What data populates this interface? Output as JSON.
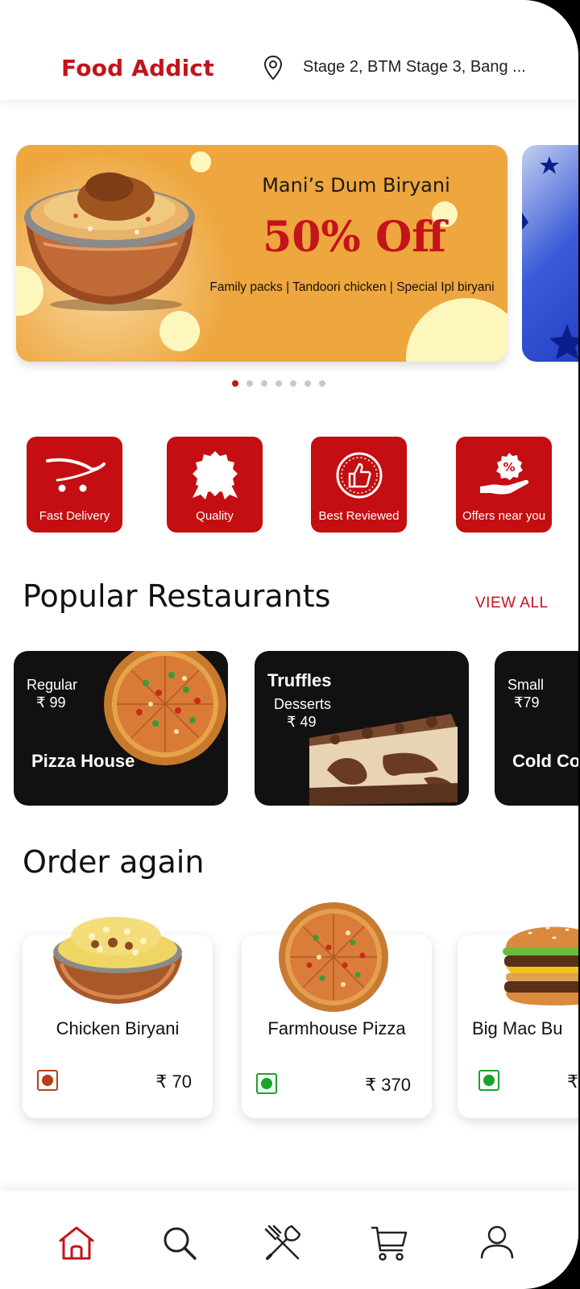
{
  "header": {
    "brand": "Food Addict",
    "location_icon": "map-pin-icon",
    "location": "Stage 2, BTM Stage 3, Bang ..."
  },
  "banner": {
    "restaurant": "Mani’s Dum Biryani",
    "offer": "50% Off",
    "features": "Family packs | Tandoori chicken | Special Ipl biryani",
    "pager": {
      "count": 7,
      "active_index": 0
    }
  },
  "categories": [
    {
      "label": "Fast Delivery",
      "icon": "cart-icon"
    },
    {
      "label": "Quality",
      "icon": "quality-badge-icon"
    },
    {
      "label": "Best Reviewed",
      "icon": "thumbs-up-icon"
    },
    {
      "label": "Offers near you",
      "icon": "offer-hand-icon"
    }
  ],
  "popular": {
    "title": "Popular Restaurants",
    "view_all": "VIEW ALL",
    "restaurants": [
      {
        "size": "Regular",
        "price": "₹ 99",
        "name": "Pizza House"
      },
      {
        "size": "Desserts",
        "price": "₹ 49",
        "name": "Truffles"
      },
      {
        "size": "Small",
        "price": "₹79",
        "name": "Cold Co"
      }
    ]
  },
  "order_again": {
    "title": "Order again",
    "items": [
      {
        "name": "Chicken Biryani",
        "price": "₹ 70",
        "type": "non-veg"
      },
      {
        "name": "Farmhouse Pizza",
        "price": "₹ 370",
        "type": "veg"
      },
      {
        "name": "Big Mac Bu",
        "price": "₹",
        "type": "veg"
      }
    ]
  },
  "nav": {
    "items": [
      {
        "icon": "home-icon",
        "active": true
      },
      {
        "icon": "search-icon",
        "active": false
      },
      {
        "icon": "restaurant-cutlery-icon",
        "active": false
      },
      {
        "icon": "cart-icon",
        "active": false
      },
      {
        "icon": "profile-icon",
        "active": false
      }
    ]
  },
  "colors": {
    "brand": "#c3131c",
    "banner_bg": "#eea63e",
    "card_dark": "#111111",
    "veg": "#1aa32a",
    "non_veg": "#b5401a"
  }
}
